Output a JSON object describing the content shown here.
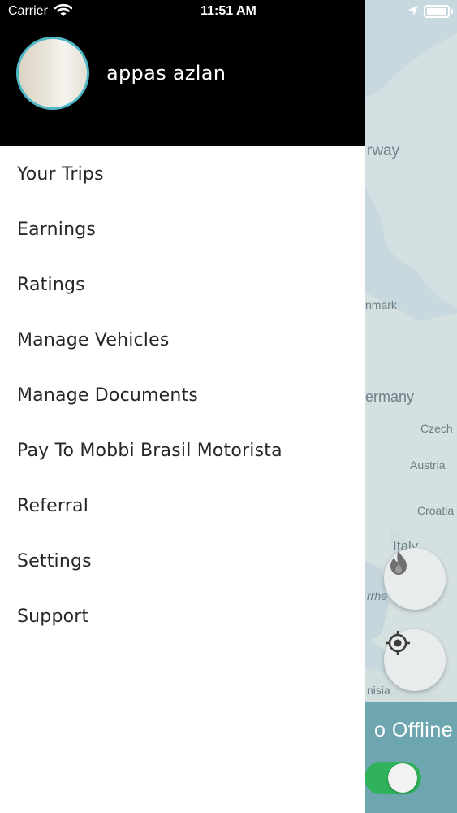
{
  "status_bar": {
    "carrier": "Carrier",
    "time": "11:51 AM"
  },
  "user": {
    "name": "appas azlan"
  },
  "menu": {
    "items": [
      {
        "label": "Your Trips"
      },
      {
        "label": "Earnings"
      },
      {
        "label": "Ratings"
      },
      {
        "label": "Manage Vehicles"
      },
      {
        "label": "Manage Documents"
      },
      {
        "label": "Pay To Mobbi Brasil Motorista"
      },
      {
        "label": "Referral"
      },
      {
        "label": "Settings"
      },
      {
        "label": "Support"
      }
    ]
  },
  "map": {
    "labels": {
      "norway": "rway",
      "denmark": "nmark",
      "germany": "ermany",
      "czech": "Czech",
      "austria": "Austria",
      "croatia": "Croatia",
      "italy": "Italy",
      "tyrrhenian": "rrhe",
      "tunisia": "nisia"
    }
  },
  "status_control": {
    "offline_label": "o Offline"
  },
  "icons": {
    "heat": "flame-icon",
    "locate": "crosshair-icon"
  },
  "colors": {
    "header_bg": "#000000",
    "avatar_ring": "#4fb6c6",
    "toggle_on": "#2fb25a",
    "offline_bar": "#6ea6b0"
  }
}
